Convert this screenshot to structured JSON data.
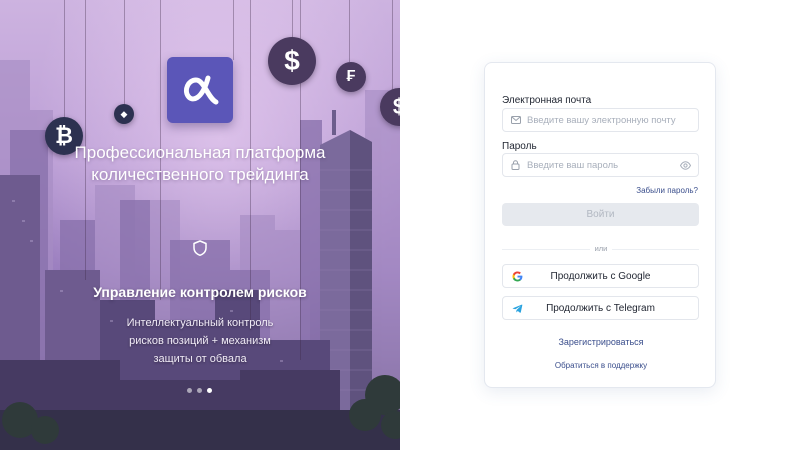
{
  "hero": {
    "logo_symbol": "α",
    "title_line1": "Профессиональная платформа",
    "title_line2": "количественного трейдинга",
    "feature_icon": "shield-icon",
    "feature_title": "Управление контролем рисков",
    "feature_desc_line1": "Интеллектуальный контроль",
    "feature_desc_line2": "рисков позиций + механизм",
    "feature_desc_line3": "защиты от обвала",
    "slides_total": 3,
    "slide_active": 3,
    "coins": [
      {
        "symbol": "₿",
        "icon": "bitcoin-icon"
      },
      {
        "symbol": "$",
        "icon": "dollar-icon"
      },
      {
        "symbol": "₣",
        "icon": "franc-icon"
      },
      {
        "symbol": "$",
        "icon": "dollar-icon"
      },
      {
        "symbol": "◆",
        "icon": "gem-icon"
      }
    ]
  },
  "form": {
    "email_label": "Электронная почта",
    "email_placeholder": "Введите вашу электронную почту",
    "email_value": "",
    "password_label": "Пароль",
    "password_placeholder": "Введите ваш пароль",
    "password_value": "",
    "forgot_label": "Забыли пароль?",
    "login_label": "Войти",
    "divider_label": "или",
    "google_label": "Продолжить с Google",
    "telegram_label": "Продолжить с Telegram",
    "register_label": "Зарегистрироваться",
    "support_label": "Обратиться в поддержку"
  },
  "colors": {
    "accent": "#5b56b8",
    "link": "#3a4e8c",
    "disabled_button": "#e6e9ee",
    "google_blue": "#4285f4",
    "telegram_blue": "#2aa3df"
  }
}
